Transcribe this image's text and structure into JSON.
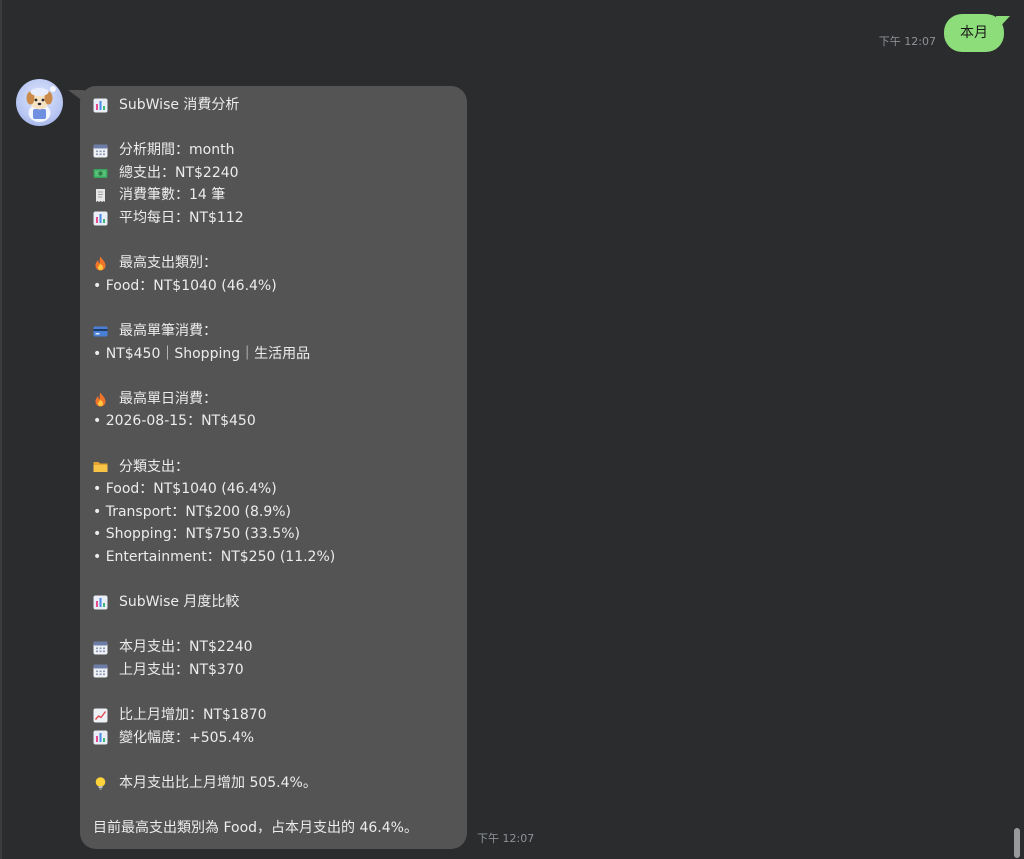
{
  "outgoing": {
    "time": "下午 12:07",
    "text": "本月"
  },
  "incoming": {
    "time": "下午 12:07",
    "lines": [
      {
        "icon": "bar-chart-icon",
        "text": "SubWise 消費分析"
      },
      {
        "icon": "",
        "text": ""
      },
      {
        "icon": "calendar-icon",
        "text": "分析期間：month"
      },
      {
        "icon": "money-icon",
        "text": "總支出：NT$2240"
      },
      {
        "icon": "receipt-icon",
        "text": "消費筆數：14 筆"
      },
      {
        "icon": "bar-chart-icon",
        "text": "平均每日：NT$112"
      },
      {
        "icon": "",
        "text": ""
      },
      {
        "icon": "fire-icon",
        "text": "最高支出類別："
      },
      {
        "icon": "",
        "text": "• Food：NT$1040 (46.4%)"
      },
      {
        "icon": "",
        "text": ""
      },
      {
        "icon": "credit-card-icon",
        "text": "最高單筆消費："
      },
      {
        "icon": "",
        "text": "• NT$450｜Shopping｜生活用品"
      },
      {
        "icon": "",
        "text": ""
      },
      {
        "icon": "fire-icon",
        "text": "最高單日消費："
      },
      {
        "icon": "",
        "text": "• 2026-08-15：NT$450"
      },
      {
        "icon": "",
        "text": ""
      },
      {
        "icon": "folder-icon",
        "text": "分類支出："
      },
      {
        "icon": "",
        "text": "• Food：NT$1040 (46.4%)"
      },
      {
        "icon": "",
        "text": "• Transport：NT$200 (8.9%)"
      },
      {
        "icon": "",
        "text": "• Shopping：NT$750 (33.5%)"
      },
      {
        "icon": "",
        "text": "• Entertainment：NT$250 (11.2%)"
      },
      {
        "icon": "",
        "text": ""
      },
      {
        "icon": "bar-chart-icon",
        "text": "SubWise 月度比較"
      },
      {
        "icon": "",
        "text": ""
      },
      {
        "icon": "calendar-icon",
        "text": "本月支出：NT$2240"
      },
      {
        "icon": "calendar-icon",
        "text": "上月支出：NT$370"
      },
      {
        "icon": "",
        "text": ""
      },
      {
        "icon": "trend-up-icon",
        "text": "比上月增加：NT$1870"
      },
      {
        "icon": "bar-chart-icon",
        "text": "變化幅度：+505.4%"
      },
      {
        "icon": "",
        "text": ""
      },
      {
        "icon": "lightbulb-icon",
        "text": "本月支出比上月增加 505.4%。"
      },
      {
        "icon": "",
        "text": ""
      },
      {
        "icon": "",
        "text": "目前最高支出類別為 Food，占本月支出的 46.4%。"
      }
    ]
  },
  "colors": {
    "background": "#2b2c2e",
    "outgoing_bubble": "#8ddd7b",
    "incoming_bubble": "#545454",
    "timestamp": "#8e9297"
  }
}
